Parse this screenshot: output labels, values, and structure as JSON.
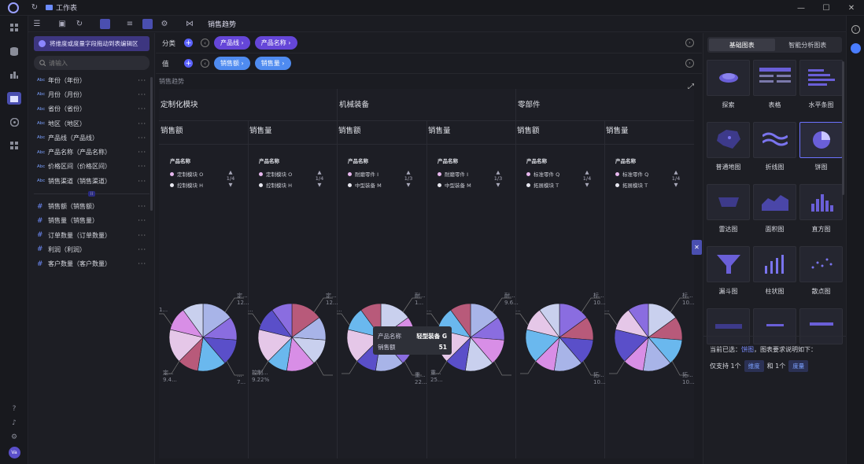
{
  "window": {
    "title": "工作表"
  },
  "toolbar": {
    "title": "销售趋势"
  },
  "fields": {
    "hint": "将维度或度量字段拖动到表编辑区",
    "search_placeholder": "请输入",
    "dimension_tag": "Abc",
    "measure_tag": "#",
    "dimensions": [
      "年份（年份）",
      "月份（月份）",
      "省份（省份）",
      "地区（地区）",
      "产品线（产品线）",
      "产品名称（产品名称）",
      "价格区间（价格区间）",
      "销售渠道（销售渠道）"
    ],
    "measures": [
      "销售额（销售额）",
      "销售量（销售量）",
      "订单数量（订单数量）",
      "利润（利润）",
      "客户数量（客户数量）"
    ],
    "more": "···"
  },
  "shelves": {
    "category": {
      "label": "分类",
      "pills": [
        "产品线 ›",
        "产品名称 ›"
      ]
    },
    "value": {
      "label": "值",
      "pills": [
        "销售额 ›",
        "销售量 ›"
      ]
    }
  },
  "canvas": {
    "title": "销售趋势",
    "groups": [
      "定制化模块",
      "机械装备",
      "零部件"
    ],
    "measure_labels": [
      "销售额",
      "销售量",
      "销售额",
      "销售量",
      "销售额",
      "销售量"
    ],
    "legends": [
      {
        "title": "产品名称",
        "items": [
          "定制模块 O",
          "控制模块 H"
        ],
        "pager": "1/4"
      },
      {
        "title": "产品名称",
        "items": [
          "定制模块 O",
          "控制模块 H"
        ],
        "pager": "1/4"
      },
      {
        "title": "产品名称",
        "items": [
          "耐磨零件 I",
          "中型装备 M"
        ],
        "pager": "1/3"
      },
      {
        "title": "产品名称",
        "items": [
          "耐磨零件 I",
          "中型装备 M"
        ],
        "pager": "1/3"
      },
      {
        "title": "产品名称",
        "items": [
          "标准零件 Q",
          "拓展模块 T"
        ],
        "pager": "1/4"
      },
      {
        "title": "产品名称",
        "items": [
          "标准零件 Q",
          "拓展模块 T"
        ],
        "pager": "1/4"
      }
    ],
    "pie_labels": [
      {
        "tr": "定...",
        "tr2": "12...",
        "bl": "定...",
        "bl2": "9.4...",
        "br": "...",
        "br2": "7...",
        "l": "1..."
      },
      {
        "tr": "定...",
        "tr2": "12...",
        "bl": "控制...",
        "bl2": "9.22%",
        "l": "..."
      },
      {
        "tr": "耐...",
        "tr2": "1...",
        "br": "重...",
        "br2": "22...",
        "l": "..."
      },
      {
        "tr": "耐...",
        "tr2": "9.6...",
        "bl": "重...",
        "bl2": "25...",
        "l": "..."
      },
      {
        "tr": "标...",
        "tr2": "10...",
        "br": "拓...",
        "br2": "10...",
        "l": "..."
      },
      {
        "tr": "标...",
        "tr2": "10...",
        "br": "拓...",
        "br2": "10...",
        "l": "..."
      }
    ],
    "tooltip": {
      "k1": "产品名称",
      "v1": "轻型装备 G",
      "k2": "销售额",
      "v2": "51"
    }
  },
  "pie_colors": [
    "#a8b4e8",
    "#d88ee6",
    "#5a4fc9",
    "#6ab8ee",
    "#b85a7a",
    "#e5c7e8",
    "#8a6de0",
    "#c9d0ee"
  ],
  "legend_colors": [
    "#e7b8ee",
    "#e8e8f0"
  ],
  "chart_panel": {
    "tabs": [
      "基础图表",
      "智能分析图表"
    ],
    "types": [
      "探索",
      "表格",
      "水平条图",
      "普通地图",
      "折线图",
      "饼图",
      "雷达图",
      "面积图",
      "直方图",
      "漏斗图",
      "柱状图",
      "散点图",
      "",
      "",
      ""
    ],
    "current_prefix": "当前已选：",
    "current": "饼图",
    "current_suffix": "，图表要求说明如下：",
    "req_prefix": "仅支持 1个",
    "req_dim": "维度",
    "req_mid": "和 1个",
    "req_mea": "度量"
  },
  "user": {
    "avatar": "Va"
  }
}
